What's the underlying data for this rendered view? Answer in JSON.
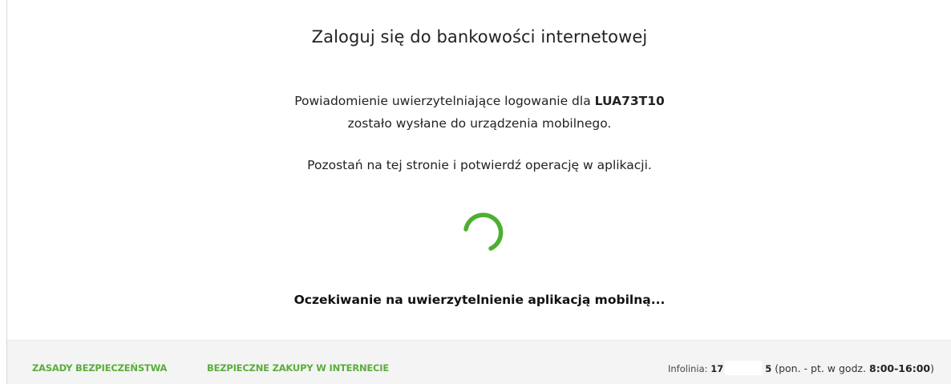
{
  "login": {
    "title": "Zaloguj się do bankowości internetowej",
    "notify_prefix": "Powiadomienie uwierzytelniające logowanie dla ",
    "user_id": "LUA73T10",
    "notify_line2": "zostało wysłane do urządzenia mobilnego.",
    "instruction": "Pozostań na tej stronie i potwierdź operację w aplikacji.",
    "waiting": "Oczekiwanie na uwierzytelnienie aplikacją mobilną...",
    "spinner_color": "#4caf2f",
    "spinner_icon": "loading-spinner-icon"
  },
  "footer": {
    "link_security": "ZASADY BEZPIECZEŃSTWA",
    "link_shopping": "BEZPIECZNE ZAKUPY W INTERNECIE",
    "hotline_label": "Infolinia: ",
    "hotline_number_start": "17",
    "hotline_number_end": "5",
    "hotline_hours_prefix": " (pon. - pt. w godz. ",
    "hotline_hours": "8:00-16:00",
    "hotline_hours_suffix": ")",
    "link_color": "#5bad3c"
  }
}
